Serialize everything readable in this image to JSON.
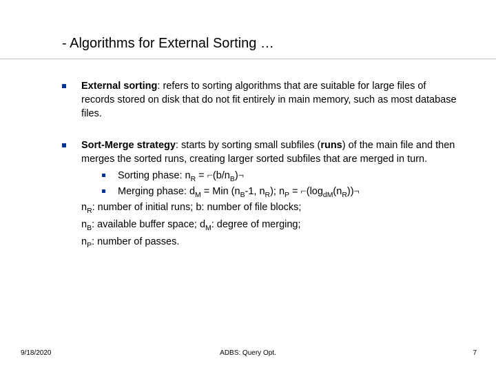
{
  "title": "- Algorithms for External Sorting …",
  "bullets": {
    "b1": {
      "bold": "External sorting",
      "rest": ": refers to sorting algorithms that are suitable for large files of records stored on disk that do not fit entirely in main memory, such as most database files."
    },
    "b2": {
      "bold": "Sort-Merge strategy",
      "rest_a": ":  starts by sorting small subfiles (",
      "runs": "runs",
      "rest_b": ") of the main file and then merges the sorted runs, creating larger sorted subfiles that are merged in turn."
    }
  },
  "sub": {
    "s1_label": "Sorting phase: n",
    "s1_sub1": "R",
    "s1_mid": " = ",
    "s1_open": "⌐",
    "s1_expr_a": "(b/n",
    "s1_sub2": "B",
    "s1_expr_b": ")",
    "s1_close": "¬",
    "s2_label": "Merging phase: d",
    "s2_sub1": "M",
    "s2_a": " = Min (n",
    "s2_sub2": "B",
    "s2_b": "-1, n",
    "s2_sub3": "R",
    "s2_c": "); n",
    "s2_sub4": "P",
    "s2_d": " = ",
    "s2_open": "⌐",
    "s2_e": "(log",
    "s2_sub5": "dM",
    "s2_f": "(n",
    "s2_sub6": "R",
    "s2_g": "))",
    "s2_close": "¬"
  },
  "defs": {
    "d1_a": "n",
    "d1_sub1": "R",
    "d1_b": ": number of initial runs; b: number of file blocks;",
    "d2_a": "n",
    "d2_sub1": "B",
    "d2_b": ": available buffer space; d",
    "d2_sub2": "M",
    "d2_c": ": degree of merging;",
    "d3_a": "n",
    "d3_sub1": "P",
    "d3_b": ": number of passes."
  },
  "footer": {
    "date": "9/18/2020",
    "center": "ADBS: Query Opt.",
    "page": "7"
  }
}
